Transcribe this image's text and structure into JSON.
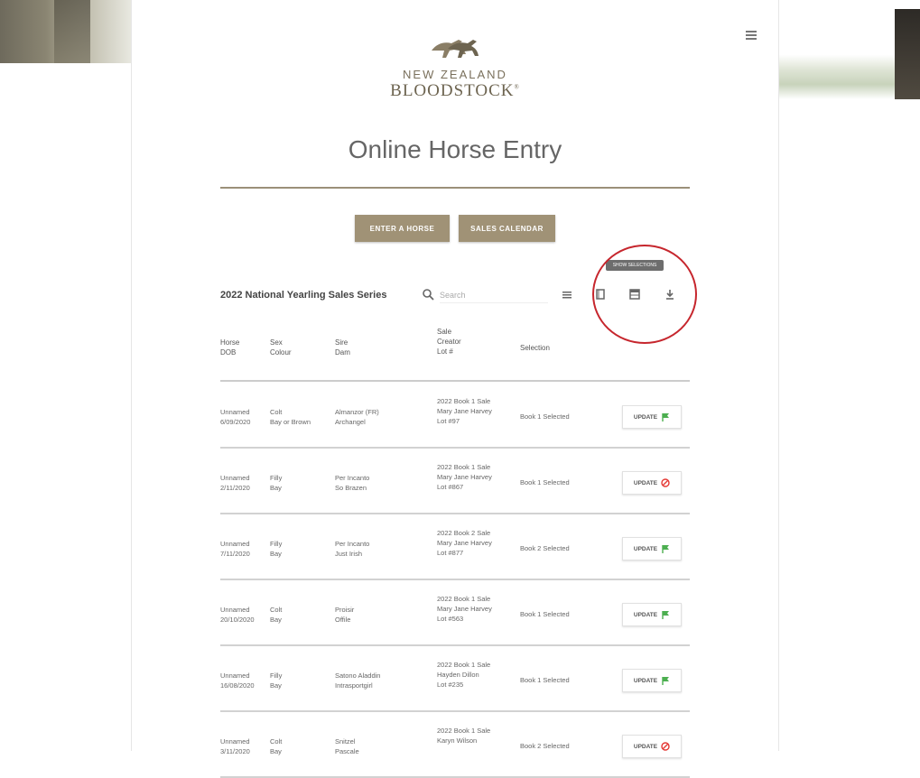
{
  "header": {
    "logo_line1": "NEW ZEALAND",
    "logo_line2": "BLOODSTOCK",
    "logo_trademark": "®",
    "page_title": "Online Horse Entry"
  },
  "actions": {
    "enter_horse": "ENTER A HORSE",
    "sales_calendar": "SALES CALENDAR"
  },
  "toolbar": {
    "series_title": "2022 National Yearling Sales Series",
    "search_placeholder": "Search",
    "tooltip": "SHOW SELECTIONS"
  },
  "columns": {
    "c1": [
      "Horse",
      "DOB"
    ],
    "c2": [
      "Sex",
      "Colour"
    ],
    "c3": [
      "Sire",
      "Dam"
    ],
    "c4": [
      "Sale",
      "Creator",
      "Lot #"
    ],
    "c5": [
      "Selection"
    ]
  },
  "rows": [
    {
      "horse": "Unnamed",
      "dob": "6/09/2020",
      "sex": "Colt",
      "colour": "Bay or Brown",
      "sire": "Almanzor (FR)",
      "dam": "Archangel",
      "sale": "2022 Book 1 Sale",
      "creator": "Mary Jane Harvey",
      "lot": "Lot #97",
      "selection": "Book 1 Selected",
      "update_label": "UPDATE",
      "status_icon": "flag"
    },
    {
      "horse": "Unnamed",
      "dob": "2/11/2020",
      "sex": "Filly",
      "colour": "Bay",
      "sire": "Per Incanto",
      "dam": "So Brazen",
      "sale": "2022 Book 1 Sale",
      "creator": "Mary Jane Harvey",
      "lot": "Lot #867",
      "selection": "Book 1 Selected",
      "update_label": "UPDATE",
      "status_icon": "ban"
    },
    {
      "horse": "Unnamed",
      "dob": "7/11/2020",
      "sex": "Filly",
      "colour": "Bay",
      "sire": "Per Incanto",
      "dam": "Just Irish",
      "sale": "2022 Book 2 Sale",
      "creator": "Mary Jane Harvey",
      "lot": "Lot #877",
      "selection": "Book 2 Selected",
      "update_label": "UPDATE",
      "status_icon": "flag"
    },
    {
      "horse": "Unnamed",
      "dob": "20/10/2020",
      "sex": "Colt",
      "colour": "Bay",
      "sire": "Proisir",
      "dam": "Offile",
      "sale": "2022 Book 1 Sale",
      "creator": "Mary Jane Harvey",
      "lot": "Lot #563",
      "selection": "Book 1 Selected",
      "update_label": "UPDATE",
      "status_icon": "flag"
    },
    {
      "horse": "Unnamed",
      "dob": "16/08/2020",
      "sex": "Filly",
      "colour": "Bay",
      "sire": "Satono Aladdin",
      "dam": "Intrasportgirl",
      "sale": "2022 Book 1 Sale",
      "creator": "Hayden Dillon",
      "lot": "Lot #235",
      "selection": "Book 1 Selected",
      "update_label": "UPDATE",
      "status_icon": "flag"
    },
    {
      "horse": "Unnamed",
      "dob": "3/11/2020",
      "sex": "Colt",
      "colour": "Bay",
      "sire": "Snitzel",
      "dam": "Pascale",
      "sale": "2022 Book 1 Sale",
      "creator": "Karyn Wilson",
      "lot": "",
      "selection": "Book 2 Selected",
      "update_label": "UPDATE",
      "status_icon": "ban"
    }
  ],
  "colors": {
    "accent": "#a09276",
    "divider": "#9b9079",
    "flag": "#4caf50",
    "ban": "#e53935",
    "highlight": "#c6262d"
  }
}
